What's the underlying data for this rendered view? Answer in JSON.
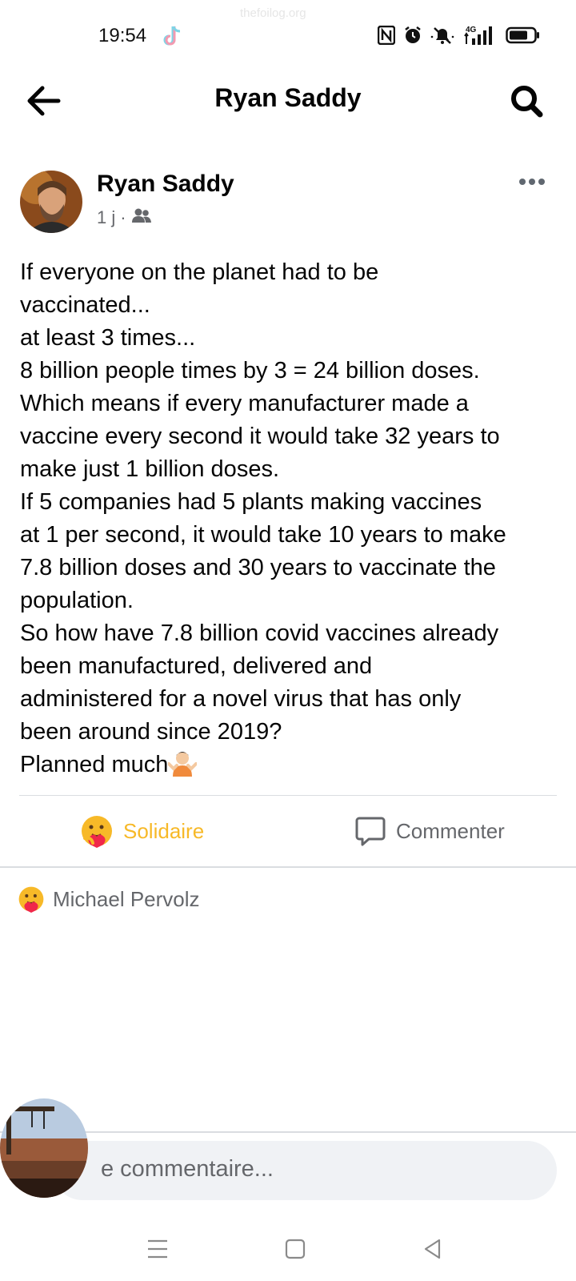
{
  "status_bar": {
    "time": "19:54",
    "watermark": "thefoilog.org",
    "network": "4G"
  },
  "header": {
    "title": "Ryan Saddy"
  },
  "post": {
    "author": "Ryan Saddy",
    "time_ago": "1 j",
    "meta_separator": "·",
    "audience_icon": "friends-icon",
    "lines": [
      "If everyone on the planet had to be",
      "vaccinated...",
      "at least 3 times...",
      "8 billion people times by 3 = 24 billion doses.",
      "Which means if every manufacturer made a",
      "vaccine every second it would take 32 years to",
      "make just 1 billion doses.",
      "If 5 companies had 5 plants making vaccines",
      "at 1 per second, it would take 10 years to make",
      "7.8 billion doses and 30 years to vaccinate the",
      "population.",
      "So how have 7.8 billion covid vaccines already",
      "been manufactured, delivered and",
      "administered for a novel virus that has only",
      "been around since 2019?"
    ],
    "last_line": "Planned much"
  },
  "actions": {
    "react_label": "Solidaire",
    "comment_label": "Commenter",
    "react_color": "#f7b928"
  },
  "reactions": {
    "reactor_name": "Michael Pervolz"
  },
  "composer": {
    "placeholder": "e commentaire..."
  }
}
